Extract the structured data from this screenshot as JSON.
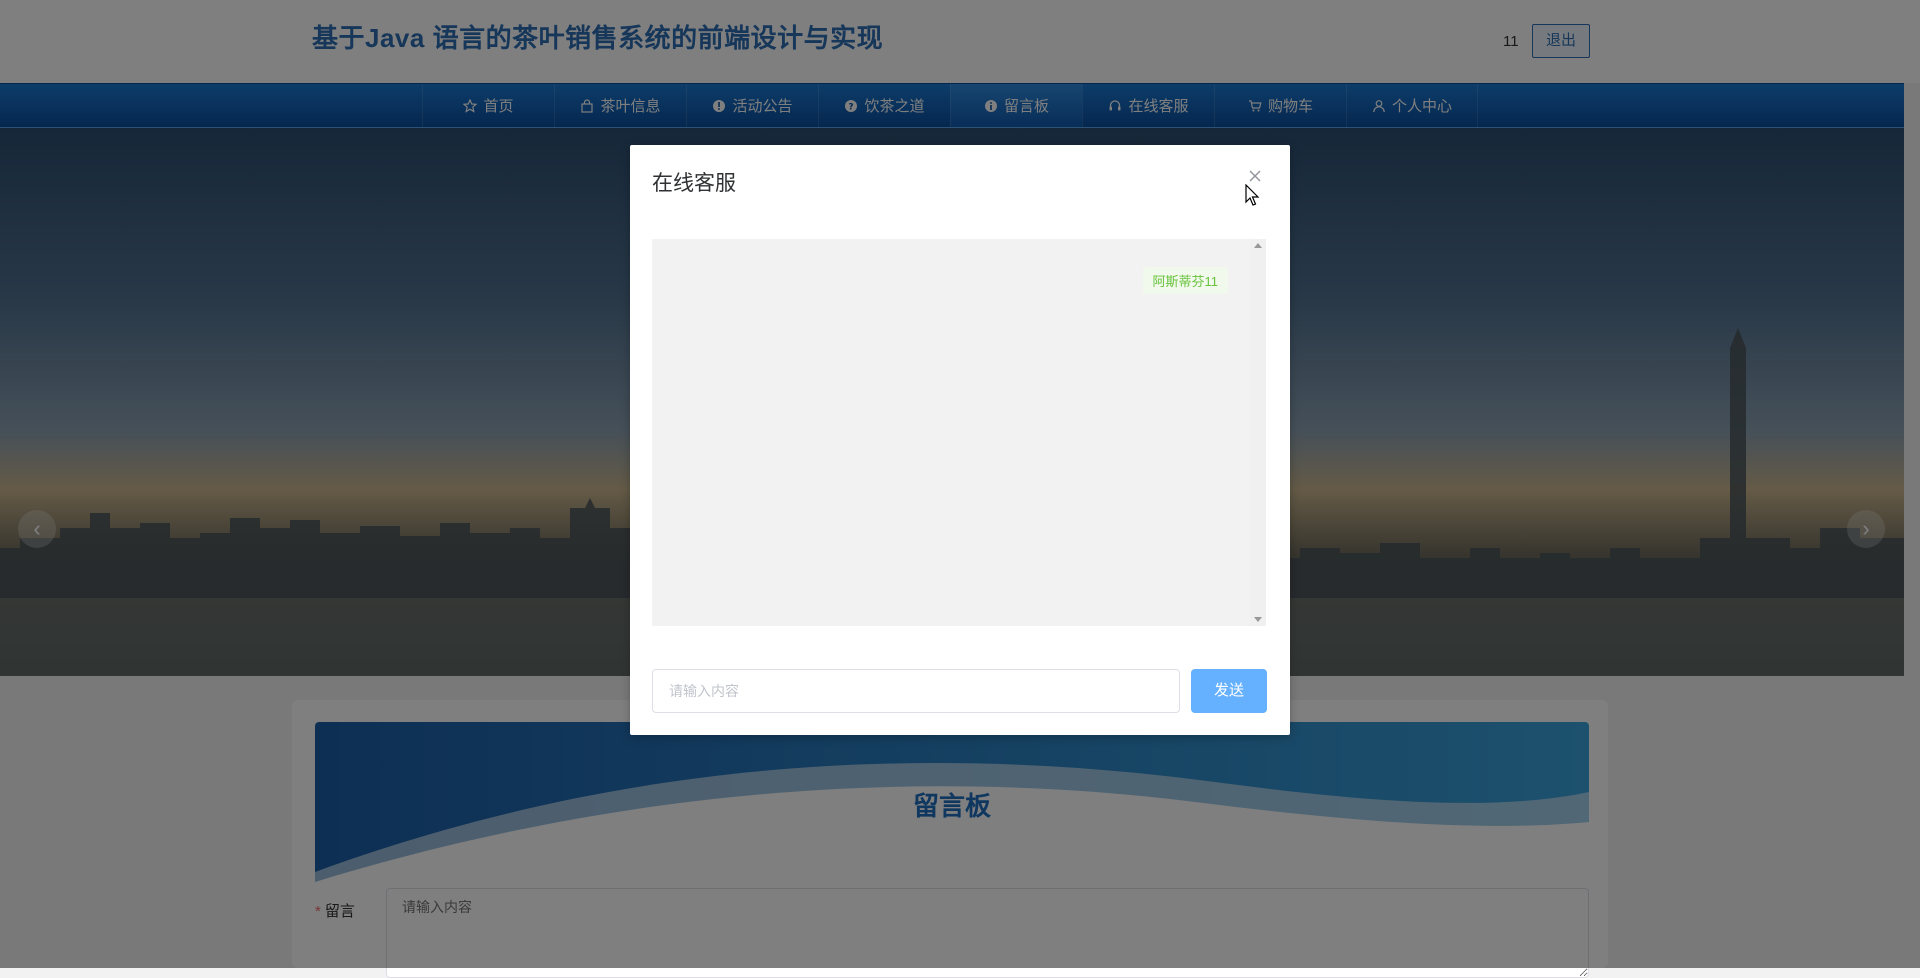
{
  "header": {
    "title": "基于Java 语言的茶叶销售系统的前端设计与实现",
    "username": "11",
    "logout_label": "退出"
  },
  "nav": {
    "items": [
      {
        "label": "首页",
        "icon": "star-icon"
      },
      {
        "label": "茶叶信息",
        "icon": "bag-icon"
      },
      {
        "label": "活动公告",
        "icon": "info-circle-icon"
      },
      {
        "label": "饮茶之道",
        "icon": "question-circle-icon"
      },
      {
        "label": "留言板",
        "icon": "info-circle-icon",
        "active": true
      },
      {
        "label": "在线客服",
        "icon": "headset-icon"
      },
      {
        "label": "购物车",
        "icon": "cart-icon"
      },
      {
        "label": "个人中心",
        "icon": "user-icon"
      }
    ]
  },
  "banner": {
    "prev_icon": "chevron-left-icon",
    "next_icon": "chevron-right-icon"
  },
  "message_board": {
    "title": "留言板",
    "label": "留言",
    "required_mark": "*",
    "placeholder": "请输入内容"
  },
  "dialog": {
    "title": "在线客服",
    "messages": [
      {
        "text": "阿斯蒂芬11",
        "side": "right"
      }
    ],
    "input_placeholder": "请输入内容",
    "send_label": "发送"
  },
  "colors": {
    "brand_blue": "#2f6fb5",
    "nav_blue": "#0b4f9e",
    "send_button": "#66b1ff",
    "bubble_text": "#67c23a"
  }
}
